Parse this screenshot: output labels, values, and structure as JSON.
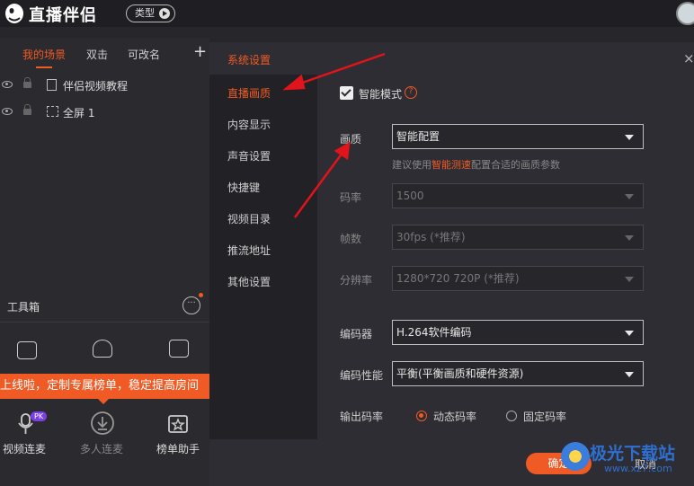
{
  "app": {
    "title": "直播伴侣",
    "type_button_label": "类型"
  },
  "scenes": {
    "tabs": [
      "我的场景",
      "双击",
      "可改名"
    ],
    "add_label": "+",
    "sources": [
      {
        "label": "伴侣视频教程"
      },
      {
        "label": "全屏 1"
      }
    ]
  },
  "toolbox": {
    "title": "工具箱",
    "more_label": "···",
    "banner_text": "上线啦，定制专属榜单，稳定提高房间",
    "pk_badge": "PK",
    "tools": [
      {
        "label": "视频连麦"
      },
      {
        "label": "多人连麦"
      },
      {
        "label": "榜单助手"
      }
    ]
  },
  "settings": {
    "nav": {
      "system": "系统设置",
      "items": [
        "直播画质",
        "内容显示",
        "声音设置",
        "快捷键",
        "视频目录",
        "推流地址",
        "其他设置"
      ]
    },
    "close_label": "×",
    "smart_mode_label": "智能模式",
    "help_label": "?",
    "quality": {
      "label": "画质",
      "value": "智能配置"
    },
    "hint": {
      "before": "建议使用",
      "link": "智能测速",
      "after": "配置合适的画质参数"
    },
    "bitrate": {
      "label": "码率",
      "value": "1500"
    },
    "framerate": {
      "label": "帧数",
      "value": "30fps (*推荐)"
    },
    "resolution": {
      "label": "分辨率",
      "value": "1280*720 720P (*推荐)"
    },
    "encoder": {
      "label": "编码器",
      "value": "H.264软件编码"
    },
    "encoder_perf": {
      "label": "编码性能",
      "value": "平衡(平衡画质和硬件资源)"
    },
    "output_bitrate": {
      "label": "输出码率",
      "options": [
        "动态码率",
        "固定码率"
      ],
      "selected": "动态码率"
    },
    "ok_label": "确定",
    "cancel_label": "取消"
  },
  "watermark": {
    "text": "极光下载站",
    "url": "www.xz7.com"
  },
  "colors": {
    "accent": "#f05a24",
    "annotation_arrow": "#e0141a",
    "watermark": "#2e6fd0"
  }
}
